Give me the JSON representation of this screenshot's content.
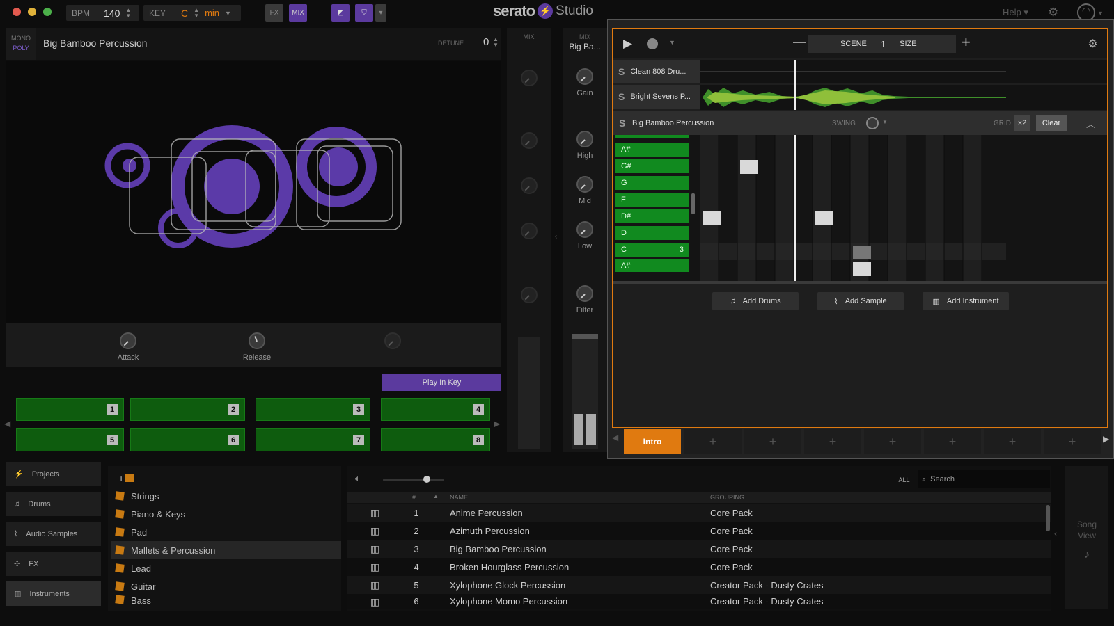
{
  "topbar": {
    "bpm_label": "BPM",
    "bpm_value": "140",
    "key_label": "KEY",
    "key_value": "C",
    "scale_value": "min",
    "fx_label": "FX",
    "mix_label": "MIX",
    "brand_serato": "serato",
    "brand_studio": "Studio",
    "help_label": "Help"
  },
  "instrument": {
    "mono": "MONO",
    "poly": "POLY",
    "name": "Big Bamboo Percussion",
    "detune_label": "DETUNE",
    "detune_value": "0",
    "attack": "Attack",
    "release": "Release",
    "play_in_key": "Play In Key",
    "pads": [
      "1",
      "2",
      "3",
      "4",
      "5",
      "6",
      "7",
      "8"
    ]
  },
  "mixer": {
    "mix_label": "MIX",
    "channel_name": "Big Ba...",
    "gain": "Gain",
    "high": "High",
    "mid": "Mid",
    "low": "Low",
    "filter": "Filter"
  },
  "song": {
    "scene_label": "SCENE",
    "scene_value": "1",
    "size_label": "SIZE",
    "tracks": [
      {
        "s": "S",
        "name": "Clean 808 Dru..."
      },
      {
        "s": "S",
        "name": "Bright Sevens P..."
      },
      {
        "s": "S",
        "name": "Big Bamboo Percussion"
      }
    ],
    "swing_label": "SWING",
    "grid_label": "GRID",
    "grid_value": "×2",
    "clear_label": "Clear",
    "notes": [
      "A#",
      "G#",
      "G",
      "F",
      "D#",
      "D",
      "C",
      "A#"
    ],
    "c_count": "3",
    "add_drums": "Add Drums",
    "add_sample": "Add Sample",
    "add_instrument": "Add Instrument",
    "scene_intro": "Intro",
    "scene_plus": "+"
  },
  "sidebar": {
    "items": [
      "Projects",
      "Drums",
      "Audio Samples",
      "FX",
      "Instruments"
    ]
  },
  "categories": [
    "Strings",
    "Piano & Keys",
    "Pad",
    "Mallets & Percussion",
    "Lead",
    "Guitar",
    "Bass"
  ],
  "library": {
    "all_label": "ALL",
    "search_placeholder": "Search",
    "col_num": "#",
    "col_name": "NAME",
    "col_group": "GROUPING",
    "rows": [
      {
        "n": "1",
        "name": "Anime Percussion",
        "group": "Core Pack"
      },
      {
        "n": "2",
        "name": "Azimuth Percussion",
        "group": "Core Pack"
      },
      {
        "n": "3",
        "name": "Big Bamboo Percussion",
        "group": "Core Pack"
      },
      {
        "n": "4",
        "name": "Broken Hourglass Percussion",
        "group": "Core Pack"
      },
      {
        "n": "5",
        "name": "Xylophone Glock Percussion",
        "group": "Creator Pack - Dusty Crates"
      },
      {
        "n": "6",
        "name": "Xylophone Momo Percussion",
        "group": "Creator Pack - Dusty Crates"
      }
    ],
    "song_view": "Song View"
  },
  "colors": {
    "accent_purple": "#5b3a9e",
    "pad_green": "#0e5c0e",
    "orange": "#e07a10"
  }
}
